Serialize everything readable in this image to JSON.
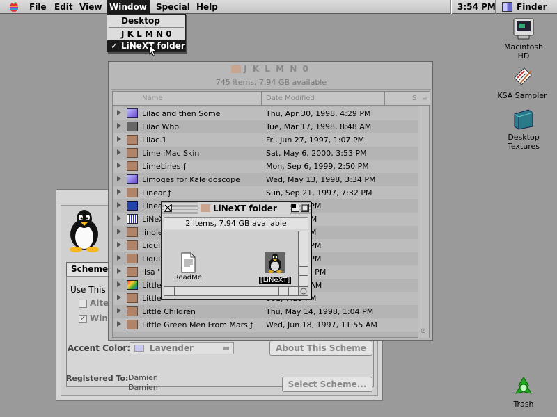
{
  "menubar": {
    "items": [
      "File",
      "Edit",
      "View",
      "Window",
      "Special",
      "Help"
    ],
    "clock": "3:54 PM",
    "app_name": "Finder"
  },
  "window_menu": {
    "items": [
      "Desktop",
      "J K L M N 0",
      "LiNeXT folder"
    ],
    "checked_item": "✓"
  },
  "desktop_icons": [
    {
      "label": "Macintosh HD",
      "icon": "hard-disk-icon"
    },
    {
      "label": "KSA Sampler",
      "icon": "sampler-doc-icon"
    },
    {
      "label": "Desktop Textures",
      "icon": "textures-folder-icon"
    },
    {
      "label": "Trash",
      "icon": "trash-icon"
    }
  ],
  "jklmno_window": {
    "title": "J K L M N 0",
    "info": "745 items, 7.94 GB available",
    "columns": {
      "name": "Name",
      "date": "Date Modified",
      "size": "S"
    },
    "rows": [
      {
        "name": "Lilac and then Some",
        "date": "Thu, Apr 30, 1998, 4:29 PM",
        "icon": "app"
      },
      {
        "name": "Lilac Who",
        "date": "Tue, Mar 17, 1998, 8:48 AM",
        "icon": "folder-dark"
      },
      {
        "name": "Lilac.1",
        "date": "Fri, Jun 27, 1997, 1:07 PM",
        "icon": "folder"
      },
      {
        "name": "Lime iMac Skin",
        "date": "Sat, May 6, 2000, 3:53 PM",
        "icon": "folder"
      },
      {
        "name": "LimeLines ƒ",
        "date": "Mon, Sep 6, 1999, 2:50 PM",
        "icon": "folder"
      },
      {
        "name": "Limoges for Kaleidoscope",
        "date": "Wed, May 13, 1998, 3:34 PM",
        "icon": "app"
      },
      {
        "name": "Linear ƒ",
        "date": "Sun, Sep 21, 1997, 7:32 PM",
        "icon": "folder"
      },
      {
        "name": "Linea",
        "date": "2000, 3:49 PM",
        "icon": "folder-blue"
      },
      {
        "name": "LiNeX",
        "date": "000, 8:48 AM",
        "icon": "app-grid"
      },
      {
        "name": "linole",
        "date": "998, 2:26 PM",
        "icon": "folder"
      },
      {
        "name": "Liqui",
        "date": "1997, 4:21 PM",
        "icon": "folder"
      },
      {
        "name": "Liqui",
        "date": "1997, 5:57 PM",
        "icon": "folder"
      },
      {
        "name": "lisa '",
        "date": "1997, 12:45 PM",
        "icon": "folder"
      },
      {
        "name": "Little",
        "date": "1998, 8:39 AM",
        "icon": "app-color"
      },
      {
        "name": "Little",
        "date": "001, 7:23 PM",
        "icon": "folder"
      },
      {
        "name": "Little Children",
        "date": "Thu, May 14, 1998, 1:04 PM",
        "icon": "folder"
      },
      {
        "name": "Little Green Men From Mars ƒ",
        "date": "Wed, Jun 18, 1997, 11:55 AM",
        "icon": "folder"
      }
    ]
  },
  "linext_window": {
    "title": "LiNeXT folder",
    "info": "2 items, 7.94 GB available",
    "items": [
      {
        "label": "ReadMe",
        "icon": "document-icon"
      },
      {
        "label": "[LiNeXT]",
        "icon": "tux-icon"
      }
    ]
  },
  "appearance_window": {
    "tab_label": "Scheme",
    "group_label": "Use This",
    "check1": "Alte",
    "check2": "Win",
    "accent_label": "Accent Color:",
    "accent_value": "Lavender",
    "about_button": "About This Scheme",
    "registered_label": "Registered To:",
    "registered_name1": "Damien",
    "registered_name2": "Damien",
    "select_button": "Select Scheme..."
  },
  "colors": {
    "desktop": "#9a9a9a",
    "menu_highlight": "#1a1a1a",
    "folder": "#b08468"
  }
}
